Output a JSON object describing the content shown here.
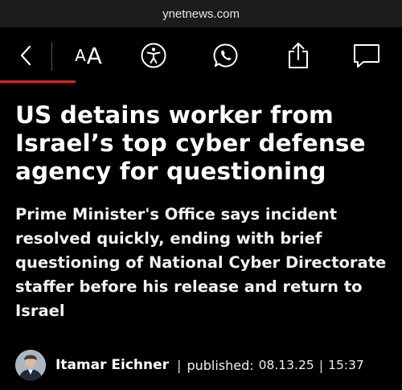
{
  "browser": {
    "url": "ynetnews.com"
  },
  "toolbar": {
    "font_size_small_glyph": "A",
    "font_size_large_glyph": "A",
    "icons": [
      "back-icon",
      "font-size-icon",
      "accessibility-icon",
      "whatsapp-icon",
      "share-icon",
      "comment-icon"
    ],
    "accent_color": "#e32219"
  },
  "article": {
    "headline": "US detains worker from Israel’s top cyber defense agency for questioning",
    "subheadline": "Prime Minister's Office says incident resolved quickly, ending with brief questioning of National Cyber Directorate staffer before his release and return to Israel",
    "author": "Itamar Eichner",
    "separator": "|",
    "published_label": "published:",
    "date": "08.13.25",
    "time": "15:37"
  }
}
